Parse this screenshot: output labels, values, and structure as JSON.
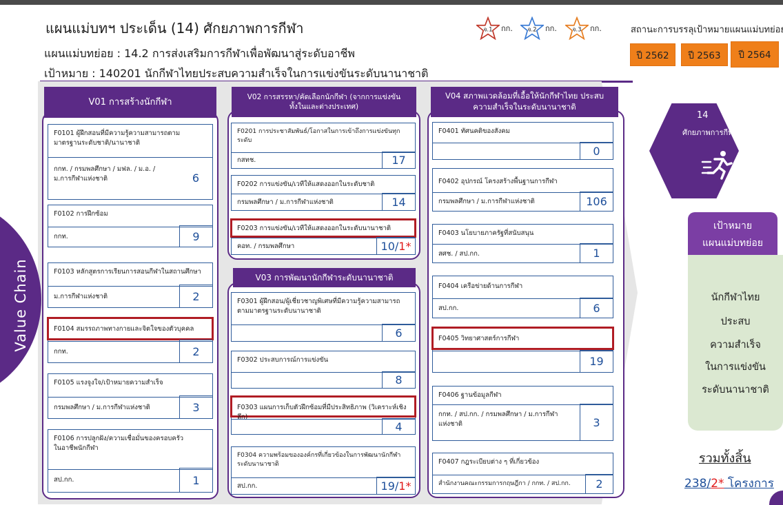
{
  "header": {
    "title": "แผนแม่บทฯ ประเด็น (14) ศักยภาพการกีฬา",
    "subplan": "แผนแม่บทย่อย : 14.2 การส่งเสริมการกีฬาเพื่อพัฒนาสู่ระดับอาชีพ",
    "target": "เป้าหมาย :   140201   นักกีฬาไทยประสบความสำเร็จในการแข่งขันระดับนานาชาติ"
  },
  "legend": [
    {
      "star": "จ.1",
      "label": "กก.",
      "color": "#c0392b"
    },
    {
      "star": "จ.2",
      "label": "กก.",
      "color": "#3b7bd4"
    },
    {
      "star": "จ.3",
      "label": "กก.",
      "color": "#e67e22"
    }
  ],
  "status": {
    "title": "สถานะการบรรลุเป้าหมายแผนแม่บทย่อย",
    "years": [
      "ปี 2562",
      "ปี 2563",
      "ปี 2564"
    ]
  },
  "value_chain_label": "Value Chain",
  "columns": [
    {
      "head": "V01 การสร้างนักกีฬา"
    },
    {
      "head": "V02 การสรรหา/คัดเลือกนักกีฬา (จากการแข่งขันทั้งในและต่างประเทศ)"
    },
    {
      "head": "V03 การพัฒนานักกีฬาระดับนานาชาติ"
    },
    {
      "head": "V04 สภาพแวดล้อมที่เอื้อให้นักกีฬาไทย ประสบความสำเร็จในระดับนานาชาติ"
    }
  ],
  "cards": {
    "f0101": {
      "title": "F0101 ผู้ฝึกสอนที่มีความรู้ความสามารถตามมาตรฐานระดับชาติ/นานาชาติ",
      "agency": "กกท. / กรมพลศึกษา / มฟล. / ม.อ. / ม.การกีฬาแห่งชาติ",
      "num": "6"
    },
    "f0102": {
      "title": "F0102 การฝึกซ้อม",
      "agency": "กกท.",
      "num": "9"
    },
    "f0103": {
      "title": "F0103 หลักสูตรการเรียนการสอนกีฬาในสถานศึกษา",
      "agency": "ม.การกีฬาแห่งชาติ",
      "num": "2"
    },
    "f0104": {
      "title": "F0104 สมรรถภาพทางกายและจิตใจของตัวบุคคล",
      "agency": "กกท.",
      "num": "2"
    },
    "f0105": {
      "title": "F0105 แรงจูงใจ/เป้าหมายความสำเร็จ",
      "agency": "กรมพลศึกษา / ม.การกีฬาแห่งชาติ",
      "num": "3"
    },
    "f0106": {
      "title": "F0106 การปลูกฝัง/ความเชื่อมั่นของครอบครัวในอาชีพนักกีฬา",
      "agency": "สป.กก.",
      "num": "1"
    },
    "f0201": {
      "title": "F0201 การประชาสัมพันธ์/โอกาสในการเข้าถึงการแข่งขันทุกระดับ",
      "agency": "กสทช.",
      "num": "17"
    },
    "f0202": {
      "title": "F0202 การแข่งขัน/เวทีให้แสดงออกในระดับชาติ",
      "agency": "กรมพลศึกษา / ม.การกีฬาแห่งชาติ",
      "num": "14"
    },
    "f0203": {
      "title": "F0203 การแข่งขัน/เวทีให้แสดงออกในระดับนานาชาติ",
      "agency": "คอท. / กรมพลศึกษา",
      "num_a": "10/",
      "num_b": "1*"
    },
    "f0301": {
      "title": "F0301 ผู้ฝึกสอน/ผู้เชี่ยวชาญพิเศษที่มีความรู้ความสามารถตามมาตรฐานระดับนานาชาติ",
      "agency": "",
      "num": "6"
    },
    "f0302": {
      "title": "F0302 ประสบการณ์การแข่งขัน",
      "agency": "",
      "num": "8"
    },
    "f0303": {
      "title": "F0303 แผนการเก็บตัวฝึกซ้อมที่มีประสิทธิภาพ (วิเคราะห์เชิงลึก)",
      "agency": "",
      "num": "4"
    },
    "f0304": {
      "title": "F0304 ความพร้อมขององค์กรที่เกี่ยวข้องในการพัฒนานักกีฬาระดับนานาชาติ",
      "agency": "สป.กก.",
      "num_a": "19/",
      "num_b": "1*"
    },
    "f0401": {
      "title": "F0401 ทัศนคติของสังคม",
      "agency": "",
      "num": "0"
    },
    "f0402": {
      "title": "F0402 อุปกรณ์ โครงสร้างพื้นฐานการกีฬา",
      "agency": "กรมพลศึกษา / ม.การกีฬาแห่งชาติ",
      "num": "106"
    },
    "f0403": {
      "title": "F0403 นโยบายภาครัฐที่สนับสนุน",
      "agency": "สศช. / สป.กก.",
      "num": "1"
    },
    "f0404": {
      "title": "F0404 เครือข่ายด้านการกีฬา",
      "agency": "สป.กก.",
      "num": "6"
    },
    "f0405": {
      "title": "F0405 วิทยาศาสตร์การกีฬา",
      "agency": "",
      "num": "19"
    },
    "f0406": {
      "title": "F0406 ฐานข้อมูลกีฬา",
      "agency": "กกท. / สป.กก. / กรมพลศึกษา / ม.การกีฬาแห่งชาติ",
      "num": "3"
    },
    "f0407": {
      "title": "F0407 กฎระเบียบต่าง ๆ ที่เกี่ยวข้อง",
      "agency": "สำนักงานคณะกรรมการกฤษฎีกา / กกท. / สป.กก.",
      "num": "2"
    }
  },
  "issue": {
    "number": "14",
    "name": "ศักยภาพการกีฬา"
  },
  "goal": {
    "label1": "เป้าหมาย",
    "label2": "แผนแม่บทย่อย",
    "lines": [
      "นักกีฬาไทย",
      "ประสบ",
      "ความสำเร็จ",
      "ในการแข่งขัน",
      "ระดับนานาชาติ"
    ]
  },
  "total": {
    "label": "รวมทั้งสิ้น",
    "value_a": "238/",
    "value_b": "2*",
    "unit": " โครงการ"
  },
  "colors": {
    "purple": "#5b2a86",
    "orange": "#ef7f1a",
    "highlight": "#b01c24",
    "goal_bg": "#dbe8d1"
  }
}
